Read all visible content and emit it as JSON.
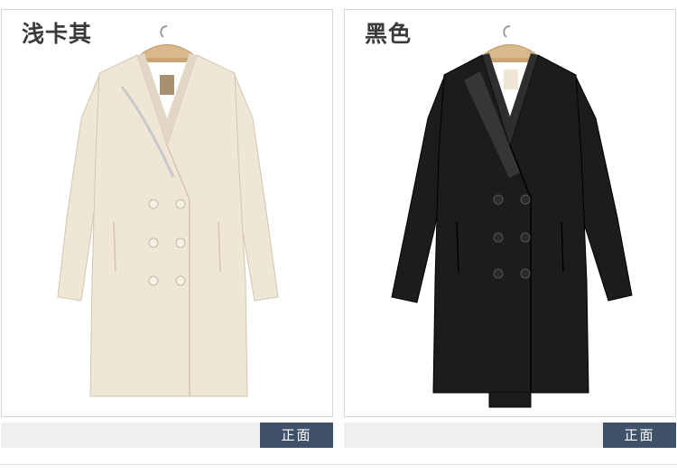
{
  "products": [
    {
      "color_label": "浅卡其",
      "view_label": "正面",
      "coat_color": "#efe6d6",
      "coat_shadow": "#d8cdb9",
      "button_color": "#f6f0e6",
      "lining_color": "#e6dccb"
    },
    {
      "color_label": "黑色",
      "view_label": "正面",
      "coat_color": "#1c1c1e",
      "coat_shadow": "#0d0d0f",
      "button_color": "#2b2b2d",
      "lining_color": "#2e2e30"
    }
  ],
  "colors": {
    "tag_bg": "#3f526a",
    "footer_bg": "#efefef",
    "panel_border": "#d6d6d6",
    "hanger": "#d9b98b"
  },
  "icons": [
    "hanger-icon",
    "coat-image"
  ]
}
